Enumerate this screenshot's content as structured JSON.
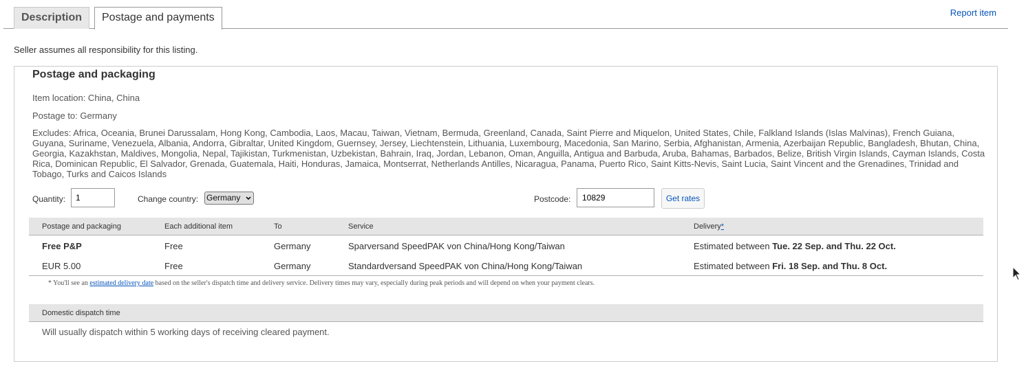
{
  "tabs": [
    {
      "label": "Description",
      "active": false
    },
    {
      "label": "Postage and payments",
      "active": true
    }
  ],
  "report_link": "Report item",
  "responsibility": "Seller assumes all responsibility for this listing.",
  "postage": {
    "title": "Postage and packaging",
    "item_location": "Item location: China, China",
    "postage_to": "Postage to: Germany",
    "excludes": "Excludes: Africa, Oceania, Brunei Darussalam, Hong Kong, Cambodia, Laos, Macau, Taiwan, Vietnam, Bermuda, Greenland, Canada, Saint Pierre and Miquelon, United States, Chile, Falkland Islands (Islas Malvinas), French Guiana, Guyana, Suriname, Venezuela, Albania, Andorra, Gibraltar, United Kingdom, Guernsey, Jersey, Liechtenstein, Lithuania, Luxembourg, Macedonia, San Marino, Serbia, Afghanistan, Armenia, Azerbaijan Republic, Bangladesh, Bhutan, China, Georgia, Kazakhstan, Maldives, Mongolia, Nepal, Tajikistan, Turkmenistan, Uzbekistan, Bahrain, Iraq, Jordan, Lebanon, Oman, Anguilla, Antigua and Barbuda, Aruba, Bahamas, Barbados, Belize, British Virgin Islands, Cayman Islands, Costa Rica, Dominican Republic, El Salvador, Grenada, Guatemala, Haiti, Honduras, Jamaica, Montserrat, Netherlands Antilles, Nicaragua, Panama, Puerto Rico, Saint Kitts-Nevis, Saint Lucia, Saint Vincent and the Grenadines, Trinidad and Tobago, Turks and Caicos Islands"
  },
  "form": {
    "quantity_label": "Quantity:",
    "quantity_value": "1",
    "country_label": "Change country:",
    "country_value": "Germany",
    "postcode_label": "Postcode:",
    "postcode_value": "10829",
    "get_rates": "Get rates"
  },
  "table": {
    "headers": {
      "postage": "Postage and packaging",
      "additional": "Each additional item",
      "to": "To",
      "service": "Service",
      "delivery": "Delivery",
      "delivery_star": "*"
    },
    "rows": [
      {
        "price": "Free P&P",
        "additional": "Free",
        "to": "Germany",
        "service": "Sparversand SpeedPAK von China/Hong Kong/Taiwan",
        "delivery_prefix": "Estimated between ",
        "delivery_dates": "Tue. 22 Sep. and Thu. 22 Oct."
      },
      {
        "price": "EUR 5.00",
        "additional": "Free",
        "to": "Germany",
        "service": "Standardversand SpeedPAK von China/Hong Kong/Taiwan",
        "delivery_prefix": "Estimated between ",
        "delivery_dates": "Fri. 18 Sep. and Thu. 8 Oct."
      }
    ],
    "footnote_prefix": "* You'll see an ",
    "footnote_link": "estimated delivery date",
    "footnote_suffix": " based on the seller's dispatch time and delivery service. Delivery times may vary, especially during peak periods and will depend on when your payment clears."
  },
  "dispatch": {
    "header": "Domestic dispatch time",
    "text": "Will usually dispatch within 5 working days of receiving cleared payment."
  },
  "colors": {
    "link": "#0654ba",
    "header_bg": "#e5e5e5"
  }
}
